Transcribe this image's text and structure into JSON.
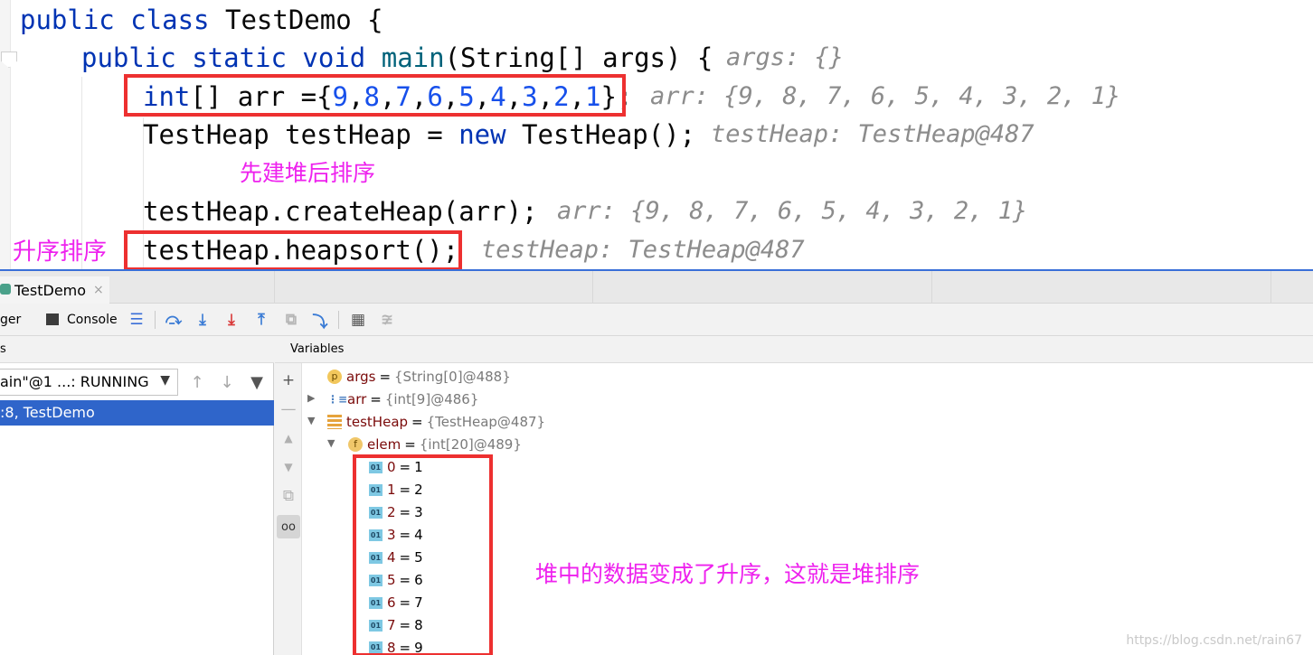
{
  "editor": {
    "lines": [
      {
        "parts": [
          [
            "kw",
            "public class "
          ],
          [
            "",
            "TestDemo {"
          ]
        ],
        "hint": ""
      },
      {
        "parts": [
          [
            "kw",
            "public static void "
          ],
          [
            "fn",
            "main"
          ],
          [
            "",
            "(String[] args) {"
          ]
        ],
        "hint": "args: {}"
      },
      {
        "parts": [
          [
            "kw",
            "int"
          ],
          [
            "",
            "[] arr ={"
          ],
          [
            "num",
            "9"
          ],
          [
            "",
            ","
          ],
          [
            "num",
            "8"
          ],
          [
            "",
            ","
          ],
          [
            "num",
            "7"
          ],
          [
            "",
            ","
          ],
          [
            "num",
            "6"
          ],
          [
            "",
            ","
          ],
          [
            "num",
            "5"
          ],
          [
            "",
            ","
          ],
          [
            "num",
            "4"
          ],
          [
            "",
            ","
          ],
          [
            "num",
            "3"
          ],
          [
            "",
            ","
          ],
          [
            "num",
            "2"
          ],
          [
            "",
            ","
          ],
          [
            "num",
            "1"
          ],
          [
            "",
            "};"
          ]
        ],
        "hint": "arr: {9, 8, 7, 6, 5, 4, 3, 2, 1}"
      },
      {
        "parts": [
          [
            "",
            "TestHeap testHeap = "
          ],
          [
            "kw",
            "new "
          ],
          [
            "",
            "TestHeap();"
          ]
        ],
        "hint": "testHeap: TestHeap@487"
      },
      {
        "parts": [
          [
            "",
            "testHeap.createHeap(arr);"
          ]
        ],
        "hint": "arr: {9, 8, 7, 6, 5, 4, 3, 2, 1}"
      },
      {
        "parts": [
          [
            "",
            "testHeap.heapsort();"
          ]
        ],
        "hint": "testHeap: TestHeap@487"
      }
    ]
  },
  "annotations": {
    "build_then_sort": "先建堆后排序",
    "ascending_sort": "升序排序",
    "result_note": "堆中的数据变成了升序，这就是堆排序"
  },
  "debug": {
    "tab_label": "TestDemo",
    "tab_close": "×",
    "toolbar": {
      "debugger_label": "ger",
      "console_label": "Console"
    },
    "frames_header": "s",
    "thread_select_value": "ain\"@1 ...: RUNNING",
    "frame_selected": ":8, TestDemo",
    "variables_header": "Variables",
    "variables": [
      {
        "name": "args",
        "value": "{String[0]@488}"
      },
      {
        "name": "arr",
        "value": "{int[9]@486}"
      },
      {
        "name": "testHeap",
        "value": "{TestHeap@487}"
      },
      {
        "name": "elem",
        "value": "{int[20]@489}"
      }
    ],
    "elem_items": [
      {
        "index": "0",
        "value": "1"
      },
      {
        "index": "1",
        "value": "2"
      },
      {
        "index": "2",
        "value": "3"
      },
      {
        "index": "3",
        "value": "4"
      },
      {
        "index": "4",
        "value": "5"
      },
      {
        "index": "5",
        "value": "6"
      },
      {
        "index": "6",
        "value": "7"
      },
      {
        "index": "7",
        "value": "8"
      },
      {
        "index": "8",
        "value": "9"
      }
    ]
  },
  "watermark": "https://blog.csdn.net/rain67",
  "colors": {
    "keyword": "#0033b3",
    "number": "#1750eb",
    "highlight_box": "#ed3030",
    "annotation": "#ee22ee",
    "selection": "#2f65ca"
  },
  "icons": [
    "step-over-icon",
    "step-into-icon",
    "force-step-into-icon",
    "step-out-icon",
    "drop-frame-icon",
    "run-to-cursor-icon",
    "evaluate-icon",
    "trace-icon",
    "add-watch-icon",
    "move-up-icon",
    "move-down-icon",
    "copy-icon",
    "glasses-icon",
    "filter-icon"
  ]
}
